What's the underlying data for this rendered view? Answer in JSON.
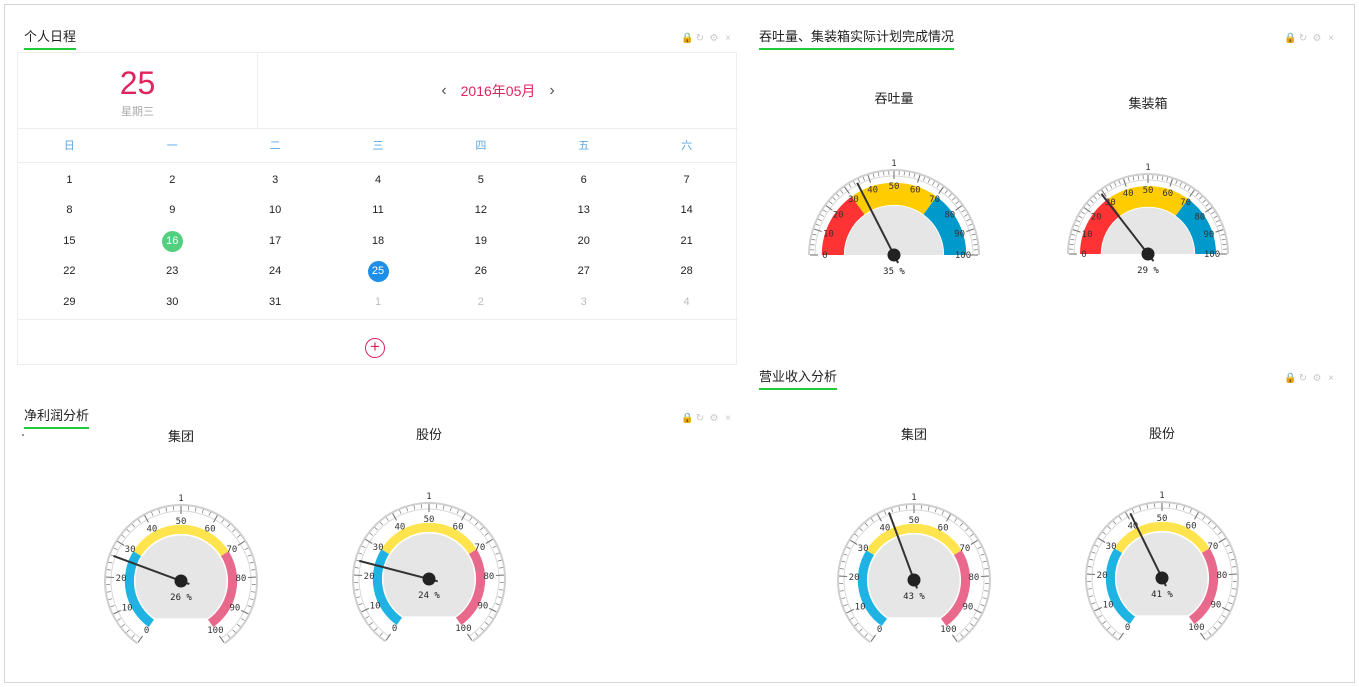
{
  "colors": {
    "accent_green": "#22c93a",
    "date_red": "#e0245e",
    "weekday_blue": "#5aa9e6",
    "marked_green": "#52cf7f",
    "marked_blue": "#1e8fe8"
  },
  "panel_tools": [
    "lock-icon",
    "refresh-icon",
    "gear-icon",
    "close-icon"
  ],
  "panel_tool_glyphs": [
    "🔒",
    "↻",
    "⚙",
    "×"
  ],
  "schedule": {
    "title": "个人日程",
    "today_day": "25",
    "today_weekday": "星期三",
    "month_label": "2016年05月",
    "prev": "‹",
    "next": "›",
    "add": "+",
    "weekdays": [
      "日",
      "一",
      "二",
      "三",
      "四",
      "五",
      "六"
    ],
    "weeks": [
      [
        {
          "d": "1"
        },
        {
          "d": "2"
        },
        {
          "d": "3"
        },
        {
          "d": "4"
        },
        {
          "d": "5"
        },
        {
          "d": "6"
        },
        {
          "d": "7"
        }
      ],
      [
        {
          "d": "8"
        },
        {
          "d": "9"
        },
        {
          "d": "10"
        },
        {
          "d": "11"
        },
        {
          "d": "12"
        },
        {
          "d": "13"
        },
        {
          "d": "14"
        }
      ],
      [
        {
          "d": "15"
        },
        {
          "d": "16",
          "mark": "green"
        },
        {
          "d": "17"
        },
        {
          "d": "18"
        },
        {
          "d": "19"
        },
        {
          "d": "20"
        },
        {
          "d": "21"
        }
      ],
      [
        {
          "d": "22"
        },
        {
          "d": "23"
        },
        {
          "d": "24"
        },
        {
          "d": "25",
          "mark": "blue"
        },
        {
          "d": "26"
        },
        {
          "d": "27"
        },
        {
          "d": "28"
        }
      ],
      [
        {
          "d": "29"
        },
        {
          "d": "30"
        },
        {
          "d": "31"
        },
        {
          "d": "1",
          "other": true
        },
        {
          "d": "2",
          "other": true
        },
        {
          "d": "3",
          "other": true
        },
        {
          "d": "4",
          "other": true
        }
      ]
    ]
  },
  "throughput": {
    "title": "吞吐量、集装箱实际计划完成情况",
    "gauges": [
      {
        "title": "吞吐量",
        "value": 35,
        "readout": "35 %",
        "ticks": [
          "0",
          "10",
          "20",
          "30",
          "40",
          "50",
          "60",
          "70",
          "80",
          "90",
          "100"
        ],
        "top_label": "1"
      },
      {
        "title": "集装箱",
        "value": 29,
        "readout": "29 %",
        "ticks": [
          "0",
          "10",
          "20",
          "30",
          "40",
          "50",
          "60",
          "70",
          "80",
          "90",
          "100"
        ],
        "top_label": "1"
      }
    ],
    "bands": [
      {
        "from": 0,
        "to": 30,
        "color": "#ff3333"
      },
      {
        "from": 30,
        "to": 70,
        "color": "#ffcc00"
      },
      {
        "from": 70,
        "to": 100,
        "color": "#0099cc"
      }
    ]
  },
  "net_profit": {
    "title": "净利润分析",
    "gauges": [
      {
        "title": "集团",
        "value": 26,
        "readout": "26 %",
        "ticks": [
          "0",
          "10",
          "20",
          "30",
          "40",
          "50",
          "60",
          "70",
          "80",
          "90",
          "100"
        ],
        "top_label": "1"
      },
      {
        "title": "股份",
        "value": 24,
        "readout": "24 %",
        "ticks": [
          "0",
          "10",
          "20",
          "30",
          "40",
          "50",
          "60",
          "70",
          "80",
          "90",
          "100"
        ],
        "top_label": "1"
      }
    ],
    "bands": [
      {
        "from": 0,
        "to": 30,
        "color": "#1fb3e3"
      },
      {
        "from": 30,
        "to": 70,
        "color": "#ffe44d"
      },
      {
        "from": 70,
        "to": 100,
        "color": "#e8698c"
      }
    ]
  },
  "revenue": {
    "title": "营业收入分析",
    "gauges": [
      {
        "title": "集团",
        "value": 43,
        "readout": "43 %",
        "ticks": [
          "0",
          "10",
          "20",
          "30",
          "40",
          "50",
          "60",
          "70",
          "80",
          "90",
          "100"
        ],
        "top_label": "1"
      },
      {
        "title": "股份",
        "value": 41,
        "readout": "41 %",
        "ticks": [
          "0",
          "10",
          "20",
          "30",
          "40",
          "50",
          "60",
          "70",
          "80",
          "90",
          "100"
        ],
        "top_label": "1"
      }
    ],
    "bands": [
      {
        "from": 0,
        "to": 30,
        "color": "#1fb3e3"
      },
      {
        "from": 30,
        "to": 70,
        "color": "#ffe44d"
      },
      {
        "from": 70,
        "to": 100,
        "color": "#e8698c"
      }
    ]
  }
}
